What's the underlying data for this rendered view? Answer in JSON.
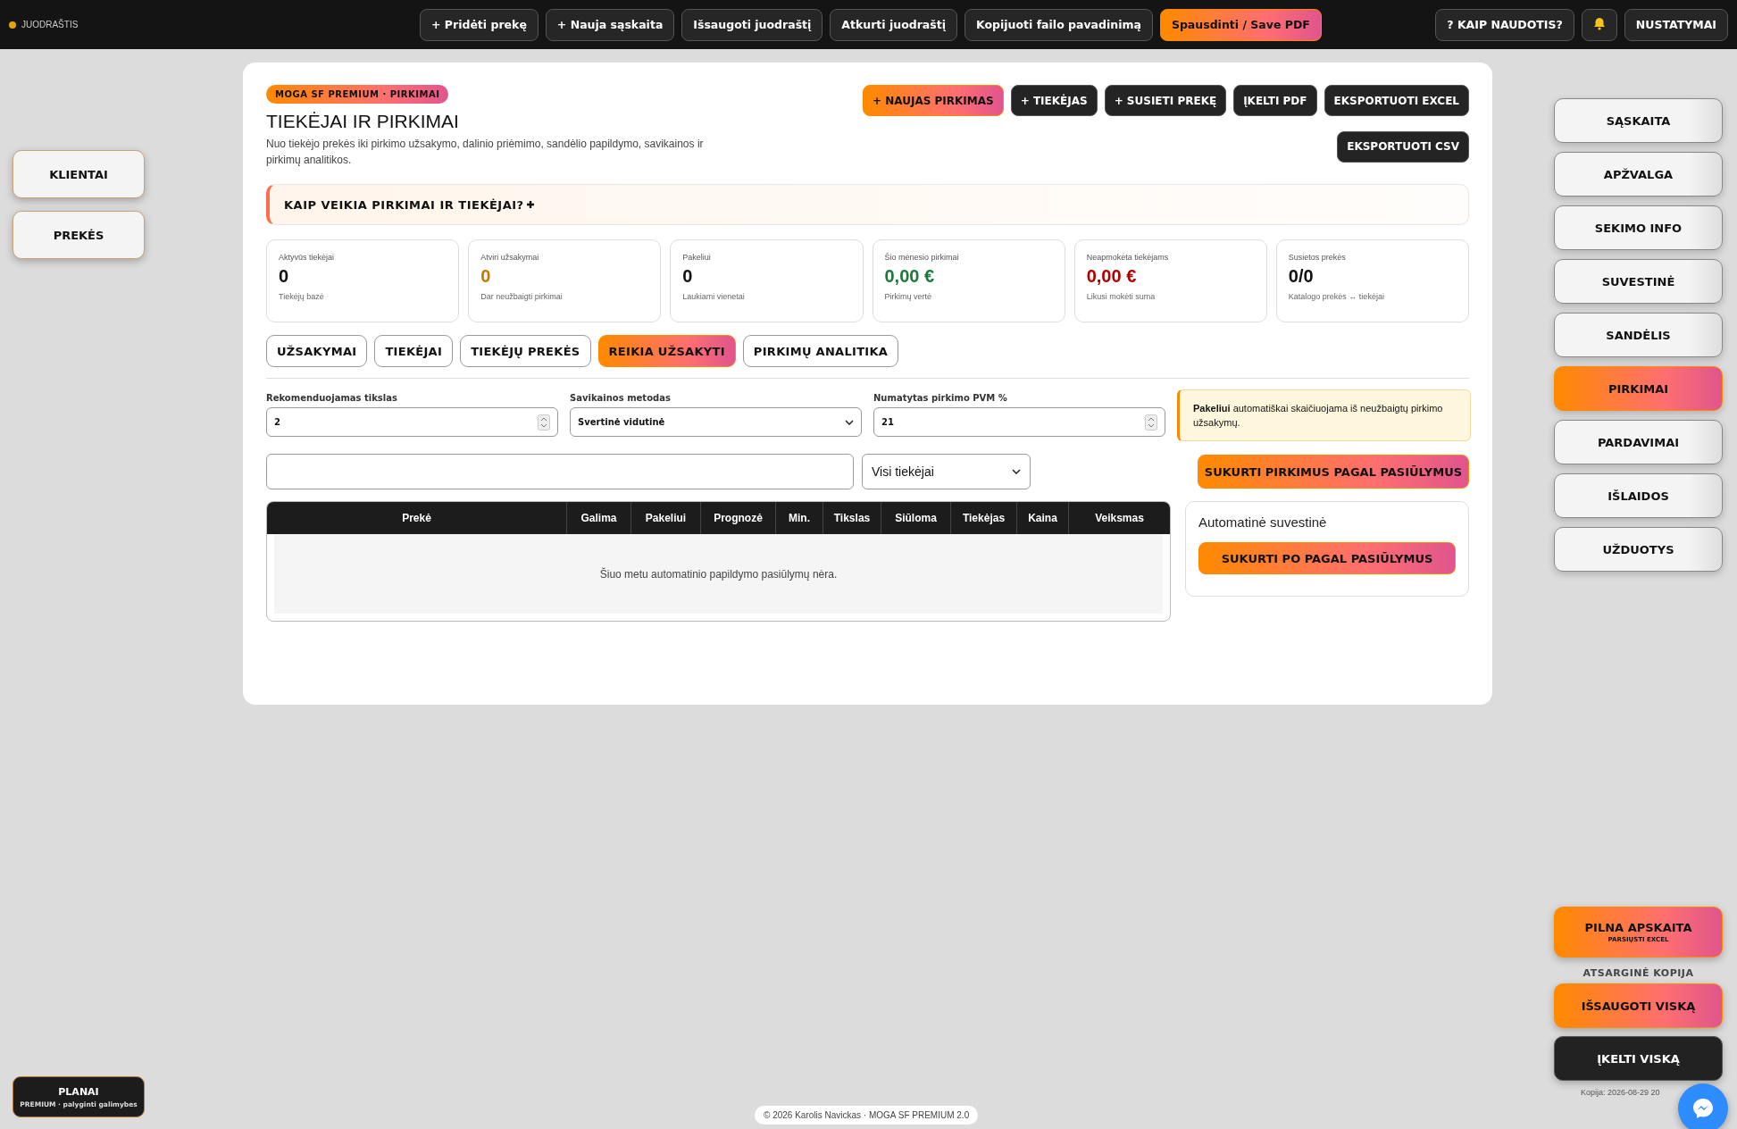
{
  "top_bar": {
    "status": {
      "label": "JUODRAŠTIS",
      "color": "#e0a800"
    },
    "actions": [
      {
        "label": "+ Pridėti prekę",
        "kind": "plain"
      },
      {
        "label": "+ Nauja sąskaita",
        "kind": "plain"
      },
      {
        "label": "Išsaugoti juodraštį",
        "kind": "plain"
      },
      {
        "label": "Atkurti juodraštį",
        "kind": "plain"
      },
      {
        "label": "Kopijuoti failo pavadinimą",
        "kind": "plain"
      },
      {
        "label": "Spausdinti / Save PDF",
        "kind": "accent"
      }
    ],
    "right": [
      {
        "label": "? KAIP NAUDOTIS?",
        "kind": "text"
      },
      {
        "kind": "bell"
      },
      {
        "label": "NUSTATYMAI",
        "kind": "text"
      }
    ]
  },
  "left_nav": [
    {
      "label": "KLIENTAI"
    },
    {
      "label": "PREKĖS"
    }
  ],
  "panel": {
    "badge": "MOGA SF PREMIUM · PIRKIMAI",
    "title": "TIEKĖJAI IR PIRKIMAI",
    "description": "Nuo tiekėjo prekės iki pirkimo užsakymo, dalinio priėmimo, sandėlio papildymo, savikainos ir pirkimų analitikos.",
    "actions": [
      {
        "label": "+ NAUJAS PIRKIMAS",
        "kind": "accent"
      },
      {
        "label": "+ TIEKĖJAS",
        "kind": "dark"
      },
      {
        "label": "+ SUSIETI PREKĘ",
        "kind": "dark"
      },
      {
        "label": "ĮKELTI PDF",
        "kind": "dark"
      },
      {
        "label": "EKSPORTUOTI EXCEL",
        "kind": "dark"
      },
      {
        "label": "EKSPORTUOTI CSV",
        "kind": "dark"
      }
    ],
    "help": {
      "label": "KAIP VEIKIA PIRKIMAI IR TIEKĖJAI?",
      "expanded": false
    },
    "stats": [
      {
        "label": "Aktyvūs tiekėjai",
        "value": "0",
        "note": "Tiekėjų bazė",
        "color": "#111111"
      },
      {
        "label": "Atviri užsakymai",
        "value": "0",
        "note": "Dar neužbaigti pirkimai",
        "color": "#c77700"
      },
      {
        "label": "Pakeliui",
        "value": "0",
        "note": "Laukiami vienetai",
        "color": "#111111"
      },
      {
        "label": "Šio mėnesio pirkimai",
        "value": "0,00 €",
        "note": "Pirkimų vertė",
        "color": "#1b7a3a"
      },
      {
        "label": "Neapmokėta tiekėjams",
        "value": "0,00 €",
        "note": "Likusi mokėti suma",
        "color": "#b00000"
      },
      {
        "label": "Susietos prekės",
        "value": "0/0",
        "note": "Katalogo prekės ↔ tiekėjai",
        "color": "#111111"
      }
    ],
    "tabs": [
      {
        "label": "UŽSAKYMAI",
        "selected": false
      },
      {
        "label": "TIEKĖJAI",
        "selected": false
      },
      {
        "label": "TIEKĖJŲ PREKĖS",
        "selected": false
      },
      {
        "label": "REIKIA UŽSAKYTI",
        "selected": true
      },
      {
        "label": "PIRKIMŲ ANALITIKA",
        "selected": false
      }
    ],
    "form": [
      {
        "label": "Rekomenduojamas tikslas",
        "value": "2",
        "kind": "number"
      },
      {
        "label": "Savikainos metodas",
        "value": "Svertinė vidutinė",
        "kind": "select"
      },
      {
        "label": "Numatytas pirkimo PVM %",
        "value": "21",
        "kind": "number"
      }
    ],
    "info_note": "**Pakeliui** automatiškai skaičiuojama iš neužbaigtų pirkimo užsakymų.",
    "filter": {
      "supplier": "Visi tiekėjai"
    },
    "create_button": "SUKURTI PIRKIMUS PAGAL PASIŪLYMUS",
    "table": {
      "columns": [
        "Prekė",
        "Galima",
        "Pakeliui",
        "Prognozė",
        "Min.",
        "Tikslas",
        "Siūloma",
        "Tiekėjas",
        "Kaina",
        "Veiksmas"
      ],
      "empty": "Šiuo metu automatinio papildymo pasiūlymų nėra."
    },
    "summary": {
      "title": "Automatinė suvestinė",
      "button": "SUKURTI PO PAGAL PASIŪLYMUS"
    }
  },
  "right_nav": [
    {
      "label": "SĄSKAITA",
      "selected": false
    },
    {
      "label": "APŽVALGA",
      "selected": false
    },
    {
      "label": "SEKIMO INFO",
      "selected": false
    },
    {
      "label": "SUVESTINĖ",
      "selected": false
    },
    {
      "label": "SANDĖLIS",
      "selected": false
    },
    {
      "label": "PIRKIMAI",
      "selected": true
    },
    {
      "label": "PARDAVIMAI",
      "selected": false
    },
    {
      "label": "IŠLAIDOS",
      "selected": false
    },
    {
      "label": "UŽDUOTYS",
      "selected": false
    }
  ],
  "backup": {
    "full": {
      "title": "PILNA APSKAITA",
      "subtitle": "PARSIŲSTI EXCEL"
    },
    "label": "ATSARGINĖ KOPIJA",
    "save": "IŠSAUGOTI VISKĄ",
    "load": "ĮKELTI VISKĄ",
    "copy_date": "Kopija: 2026-08-29 20"
  },
  "plans": {
    "title": "PLANAI",
    "subtitle": "PREMIUM · palyginti galimybes"
  },
  "footer": "© 2026 Karolis Navickas · MOGA SF PREMIUM 2.0"
}
